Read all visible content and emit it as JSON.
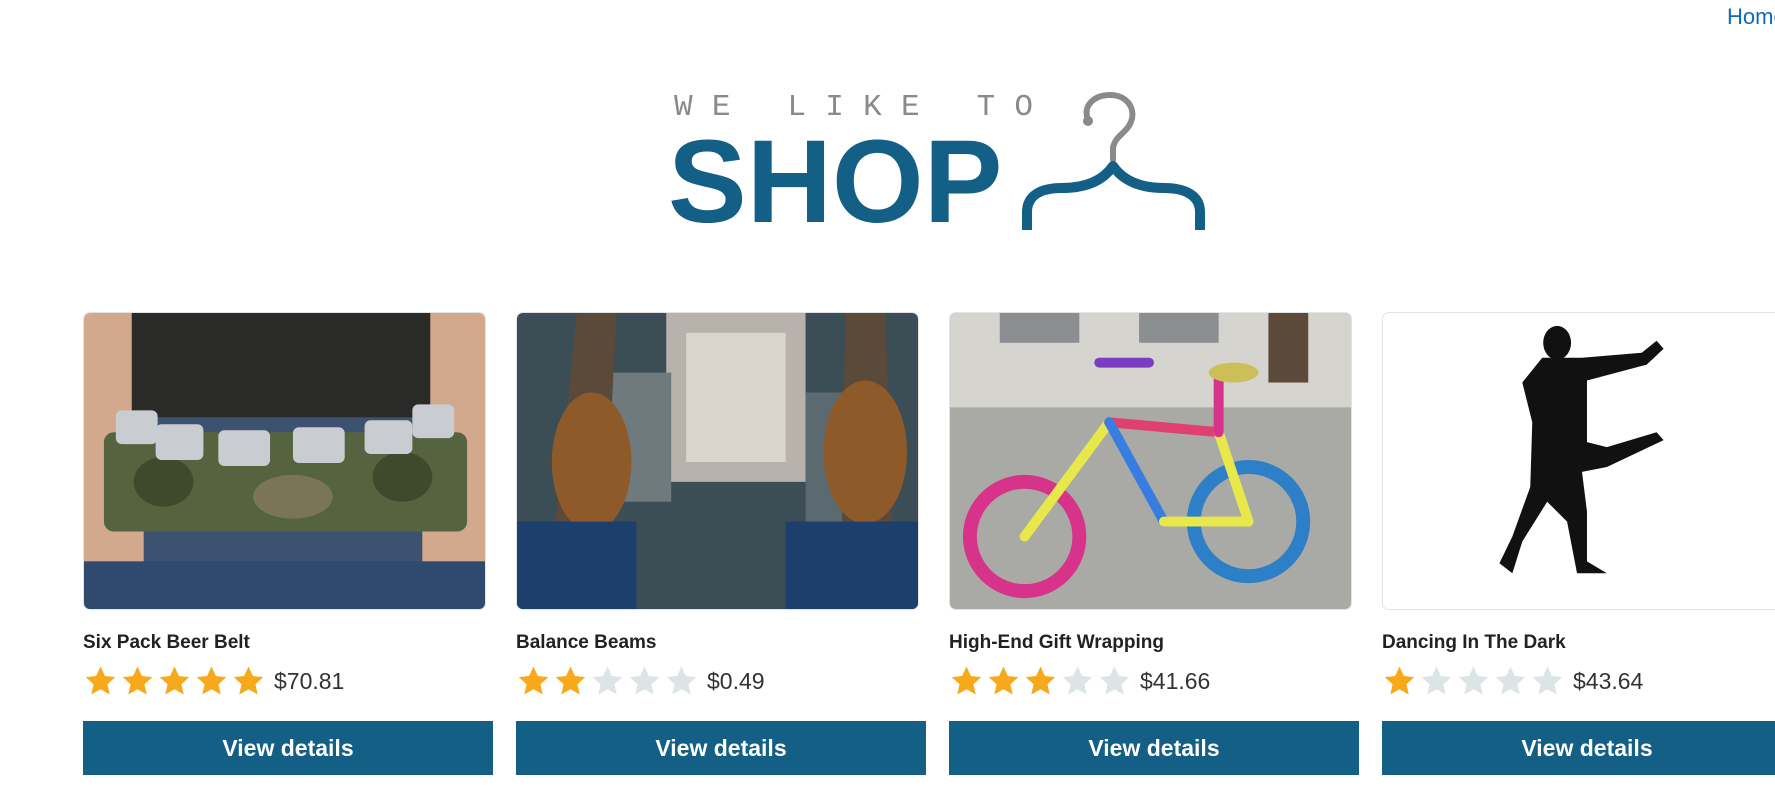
{
  "header": {
    "home_link": "Home"
  },
  "logo": {
    "tagline": "WE LIKE TO",
    "wordmark": "SHOP",
    "icon": "hanger-icon"
  },
  "colors": {
    "brand": "#135f86",
    "link": "#0d6bba",
    "star_filled": "#f7a81b",
    "star_empty": "#dde4e5"
  },
  "products": [
    {
      "name": "Six Pack Beer Belt",
      "rating": 5,
      "max_rating": 5,
      "price": "$70.81",
      "button_label": "View details"
    },
    {
      "name": "Balance Beams",
      "rating": 2,
      "max_rating": 5,
      "price": "$0.49",
      "button_label": "View details"
    },
    {
      "name": "High-End Gift Wrapping",
      "rating": 3,
      "max_rating": 5,
      "price": "$41.66",
      "button_label": "View details"
    },
    {
      "name": "Dancing In The Dark",
      "rating": 1,
      "max_rating": 5,
      "price": "$43.64",
      "button_label": "View details"
    }
  ]
}
